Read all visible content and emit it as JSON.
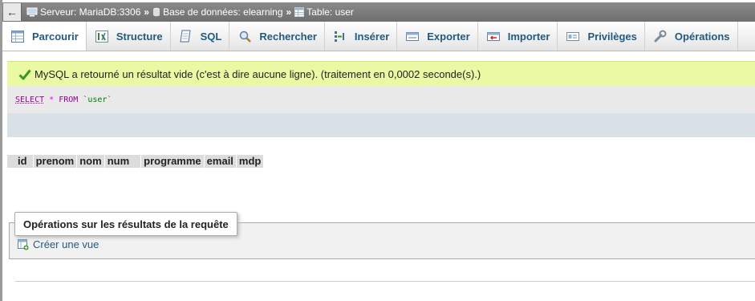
{
  "breadcrumb": {
    "back_glyph": "←",
    "server": "Serveur: MariaDB:3306",
    "database": "Base de données: elearning",
    "table": "Table: user",
    "separator": "»"
  },
  "tabs": [
    {
      "label": "Parcourir",
      "icon": "browse-icon",
      "active": true
    },
    {
      "label": "Structure",
      "icon": "structure-icon"
    },
    {
      "label": "SQL",
      "icon": "sql-icon"
    },
    {
      "label": "Rechercher",
      "icon": "search-icon"
    },
    {
      "label": "Insérer",
      "icon": "insert-icon"
    },
    {
      "label": "Exporter",
      "icon": "export-icon"
    },
    {
      "label": "Importer",
      "icon": "import-icon"
    },
    {
      "label": "Privilèges",
      "icon": "privileges-icon"
    },
    {
      "label": "Opérations",
      "icon": "wrench-icon"
    }
  ],
  "message": {
    "text": "MySQL a retourné un résultat vide (c'est à dire aucune ligne). (traitement en 0,0002 seconde(s).)",
    "icon": "check-icon"
  },
  "sql": {
    "select": "SELECT",
    "star": "*",
    "from": "FROM",
    "table": "`user`"
  },
  "columns": [
    "id",
    "prenom",
    "nom",
    "num",
    "programme",
    "email",
    "mdp"
  ],
  "operations": {
    "legend": "Opérations sur les résultats de la requête",
    "create_view": "Créer une vue",
    "create_view_icon": "create-view-icon"
  },
  "colors": {
    "tab_text": "#235a81",
    "success_bg": "#ebf8a4",
    "check": "#3a9a1a",
    "sql_keyword": "#990099",
    "sql_string": "#008000"
  }
}
